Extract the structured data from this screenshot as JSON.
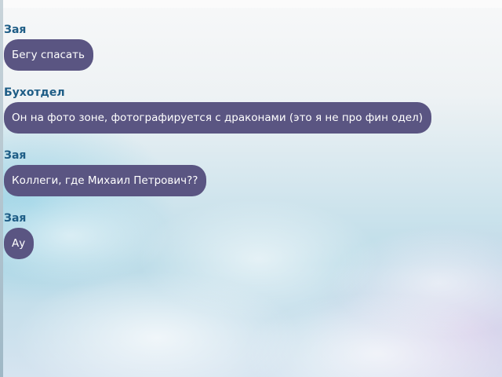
{
  "messages": [
    {
      "sender": "Зая",
      "text": "Бегу спасать"
    },
    {
      "sender": "Бухотдел",
      "text": "Он на фото зоне, фотографируется с драконами (это я не про фин одел)"
    },
    {
      "sender": "Зая",
      "text": "Коллеги, где Михаил Петрович??"
    },
    {
      "sender": "Зая",
      "text": "Ау"
    }
  ],
  "colors": {
    "bubble": "#5a5582",
    "sender": "#1e5d86",
    "bubble_text": "#ffffff"
  }
}
